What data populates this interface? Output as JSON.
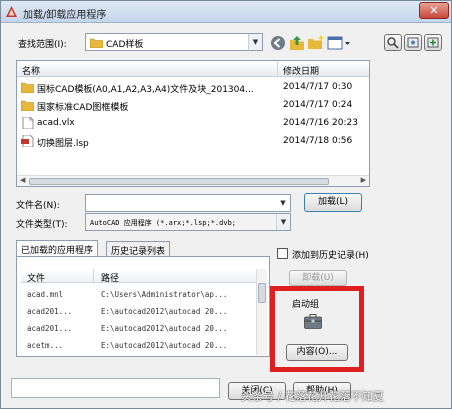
{
  "window": {
    "title": "加载/卸载应用程序",
    "close_label": "✕"
  },
  "look_in": {
    "label": "查找范围(I):",
    "value": "CAD样板"
  },
  "file_list": {
    "columns": [
      "名称",
      "修改日期"
    ],
    "rows": [
      {
        "name": "国标CAD模板(A0,A1,A2,A3,A4)文件及块_201304...",
        "date": "2014/7/17 0:30",
        "icon": "folder-icon"
      },
      {
        "name": "国家标准CAD图框模板",
        "date": "2014/7/17 0:24",
        "icon": "folder-icon"
      },
      {
        "name": "acad.vlx",
        "date": "2014/7/16 20:23",
        "icon": "file-icon"
      },
      {
        "name": "切换图层.lsp",
        "date": "2014/7/18 0:56",
        "icon": "lsp-file-icon"
      }
    ]
  },
  "file_name": {
    "label": "文件名(N):",
    "value": ""
  },
  "file_type": {
    "label": "文件类型(T):",
    "value": "AutoCAD 应用程序 (*.arx;*.lsp;*.dvb;"
  },
  "load_button": "加载(L)",
  "tabs": [
    "已加载的应用程序",
    "历史记录列表"
  ],
  "add_to_history": "添加到历史记录(H)",
  "unload_button": "卸载(U)",
  "loaded_apps": {
    "columns": [
      "文件",
      "路径"
    ],
    "rows": [
      {
        "file": "acad.mnl",
        "path": "C:\\Users\\Administrator\\ap..."
      },
      {
        "file": "acad201...",
        "path": "E:\\autocad2012\\autocad 20..."
      },
      {
        "file": "acad201...",
        "path": "E:\\autocad2012\\autocad 20..."
      },
      {
        "file": "acetm...",
        "path": "E:\\autocad2012\\autocad 20..."
      }
    ]
  },
  "startup": {
    "label": "启动组",
    "contents_button": "内容(O)..."
  },
  "close_button": "关闭(C)",
  "help_button": "帮助(H)",
  "watermark": "头条号 / 花落花开花落不知夏",
  "colors": {
    "highlight_border": "#e02020",
    "folder": "#e8b83a"
  }
}
